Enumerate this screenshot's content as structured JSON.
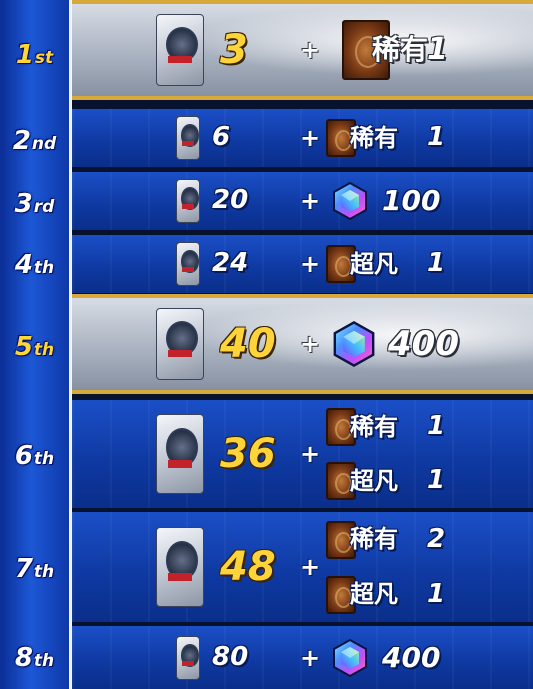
{
  "ranks": [
    {
      "num": "1",
      "suffix": "st",
      "highlight": true
    },
    {
      "num": "2",
      "suffix": "nd",
      "highlight": false
    },
    {
      "num": "3",
      "suffix": "rd",
      "highlight": false
    },
    {
      "num": "4",
      "suffix": "th",
      "highlight": false
    },
    {
      "num": "5",
      "suffix": "th",
      "highlight": true
    },
    {
      "num": "6",
      "suffix": "th",
      "highlight": false
    },
    {
      "num": "7",
      "suffix": "th",
      "highlight": false
    },
    {
      "num": "8",
      "suffix": "th",
      "highlight": false
    }
  ],
  "rows": [
    {
      "pack_count": "3",
      "plus": "+",
      "rewards": [
        {
          "kind": "card",
          "label": "稀有",
          "qty": "1"
        }
      ]
    },
    {
      "pack_count": "6",
      "plus": "+",
      "rewards": [
        {
          "kind": "card",
          "label": "稀有",
          "qty": "1"
        }
      ]
    },
    {
      "pack_count": "20",
      "plus": "+",
      "rewards": [
        {
          "kind": "gem",
          "label": "",
          "qty": "100"
        }
      ]
    },
    {
      "pack_count": "24",
      "plus": "+",
      "rewards": [
        {
          "kind": "card",
          "label": "超凡",
          "qty": "1"
        }
      ]
    },
    {
      "pack_count": "40",
      "plus": "+",
      "rewards": [
        {
          "kind": "gem",
          "label": "",
          "qty": "400"
        }
      ]
    },
    {
      "pack_count": "36",
      "plus": "+",
      "rewards": [
        {
          "kind": "card",
          "label": "稀有",
          "qty": "1"
        },
        {
          "kind": "card",
          "label": "超凡",
          "qty": "1"
        }
      ]
    },
    {
      "pack_count": "48",
      "plus": "+",
      "rewards": [
        {
          "kind": "card",
          "label": "稀有",
          "qty": "2"
        },
        {
          "kind": "card",
          "label": "超凡",
          "qty": "1"
        }
      ]
    },
    {
      "pack_count": "80",
      "plus": "+",
      "rewards": [
        {
          "kind": "gem",
          "label": "",
          "qty": "400"
        }
      ]
    }
  ],
  "colors": {
    "gold": "#ffd43a",
    "blue": "#1b4fc7",
    "silver": "#c3c9d4"
  },
  "icons": {
    "pack": "card-pack-icon",
    "card": "card-back-icon",
    "gem": "gem-icon"
  }
}
